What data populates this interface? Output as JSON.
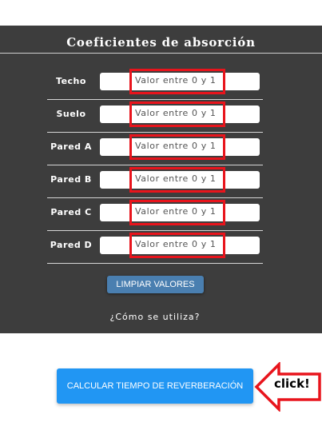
{
  "panel": {
    "title": "Coeficientes de absorción",
    "rows": [
      {
        "label": "Techo",
        "value": "",
        "placeholder": "Valor entre 0 y 1"
      },
      {
        "label": "Suelo",
        "value": "",
        "placeholder": "Valor entre 0 y 1"
      },
      {
        "label": "Pared A",
        "value": "",
        "placeholder": "Valor entre 0 y 1"
      },
      {
        "label": "Pared B",
        "value": "",
        "placeholder": "Valor entre 0 y 1"
      },
      {
        "label": "Pared C",
        "value": "",
        "placeholder": "Valor entre 0 y 1"
      },
      {
        "label": "Pared D",
        "value": "",
        "placeholder": "Valor entre 0 y 1"
      }
    ],
    "clear_button_label": "LIMPIAR VALORES",
    "how_to_link": "¿Cómo se utiliza?"
  },
  "calculate_button_label": "CALCULAR TIEMPO DE REVERBERACIÓN",
  "annotation": {
    "callout_text": "click!",
    "highlight_color": "#e8141c",
    "arrow_color": "#e8141c"
  },
  "colors": {
    "panel_background": "#3d3d3d",
    "clear_button": "#4a7fb0",
    "calculate_button": "#2196f3"
  }
}
